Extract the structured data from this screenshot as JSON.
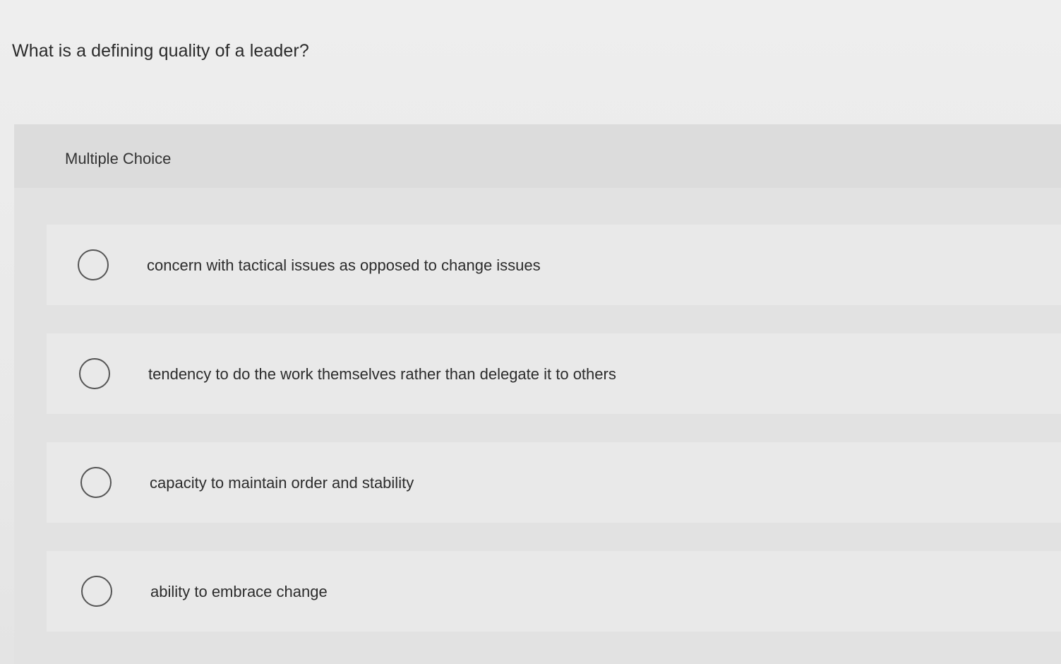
{
  "question": {
    "text": "What is a defining quality of a leader?"
  },
  "multiple_choice": {
    "label": "Multiple Choice",
    "options": [
      {
        "label": "concern with tactical issues as opposed to change issues",
        "selected": false
      },
      {
        "label": "tendency to do the work themselves rather than delegate it to others",
        "selected": false
      },
      {
        "label": "capacity to maintain order and stability",
        "selected": false
      },
      {
        "label": "ability to embrace change",
        "selected": false
      }
    ]
  }
}
